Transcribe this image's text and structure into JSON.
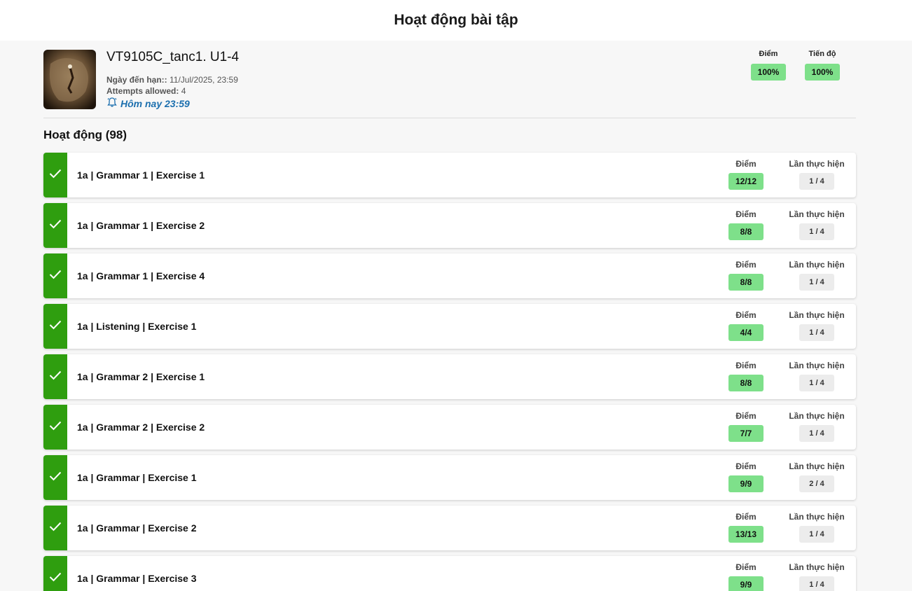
{
  "page": {
    "title": "Hoạt động bài tập"
  },
  "assignment": {
    "name": "VT9105C_tanc1. U1-4",
    "due_label": "Ngày đến hạn::",
    "due_value": "11/Jul/2025, 23:59",
    "attempts_label": "Attempts allowed:",
    "attempts_value": "4",
    "reminder": "Hôm nay 23:59",
    "score_label": "Điểm",
    "score_value": "100%",
    "progress_label": "Tiến độ",
    "progress_value": "100%"
  },
  "activities": {
    "heading": "Hoạt động (98)",
    "score_label": "Điểm",
    "attempts_label": "Lần thực hiện",
    "items": [
      {
        "name": "1a | Grammar 1 | Exercise 1",
        "score": "12/12",
        "attempts": "1 / 4"
      },
      {
        "name": "1a | Grammar 1 | Exercise 2",
        "score": "8/8",
        "attempts": "1 / 4"
      },
      {
        "name": "1a | Grammar 1 | Exercise 4",
        "score": "8/8",
        "attempts": "1 / 4"
      },
      {
        "name": "1a | Listening | Exercise 1",
        "score": "4/4",
        "attempts": "1 / 4"
      },
      {
        "name": "1a | Grammar 2 | Exercise 1",
        "score": "8/8",
        "attempts": "1 / 4"
      },
      {
        "name": "1a | Grammar 2 | Exercise 2",
        "score": "7/7",
        "attempts": "1 / 4"
      },
      {
        "name": "1a | Grammar | Exercise 1",
        "score": "9/9",
        "attempts": "2 / 4"
      },
      {
        "name": "1a | Grammar | Exercise 2",
        "score": "13/13",
        "attempts": "1 / 4"
      },
      {
        "name": "1a | Grammar | Exercise 3",
        "score": "9/9",
        "attempts": "1 / 4"
      }
    ]
  },
  "colors": {
    "complete": "#2f9e0f",
    "score_bg": "#7ee08a",
    "attempt_bg": "#ececec",
    "reminder": "#1c6fae"
  }
}
